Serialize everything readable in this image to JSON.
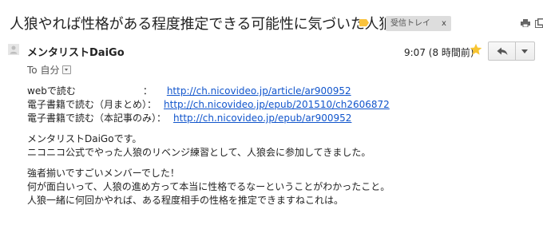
{
  "subject": {
    "title": "人狼やれば性格がある程度推定できる可能性に気づいた人狼会",
    "label_color": "#f9c23c",
    "inbox_label": "受信トレイ",
    "inbox_label_close": "x"
  },
  "header_icons": {
    "print": "print-icon",
    "popout": "popout-icon"
  },
  "sender": {
    "name": "メンタリストDaiGo",
    "to_text": "To 自分",
    "timestamp": "9:07 (8 時間前)"
  },
  "icons": {
    "star": "star-icon",
    "reply": "reply-icon",
    "more": "chevron-down-icon",
    "avatar": "person-icon"
  },
  "colors": {
    "link": "#1155cc",
    "star": "#f8c532"
  },
  "body": {
    "links": [
      {
        "label": "webで読む　　　　　　　：",
        "url": "http://ch.nicovideo.jp/article/ar900952"
      },
      {
        "label": "電子書籍で読む（月まとめ）：",
        "url": "http://ch.nicovideo.jp/epub/201510/ch2606872"
      },
      {
        "label": "電子書籍で読む（本記事のみ）：",
        "url": "http://ch.nicovideo.jp/epub/ar900952"
      }
    ],
    "para1": [
      "メンタリストDaiGoです。",
      "ニコニコ公式でやった人狼のリベンジ練習として、人狼会に参加してきました。"
    ],
    "para2": [
      "強者揃いですごいメンバーでした！",
      "何が面白いって、人狼の進め方って本当に性格でるなーということがわかったこと。",
      "人狼一緒に何回かやれば、ある程度相手の性格を推定できますねこれは。"
    ]
  }
}
